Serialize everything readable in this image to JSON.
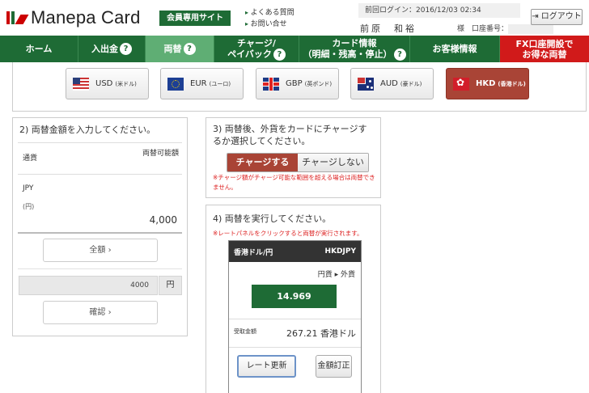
{
  "header": {
    "logo_text": "Manepa Card",
    "member_badge": "会員専用サイト",
    "links": [
      "よくある質問",
      "お問い合せ"
    ],
    "last_login": "前回ログイン：2016/12/03 02:34",
    "user_name": "前原　和裕",
    "account_label": "様　口座番号：",
    "logout_label": "ログアウト"
  },
  "nav": {
    "items": [
      {
        "label": "ホーム",
        "help": false
      },
      {
        "label": "入出金",
        "help": true
      },
      {
        "label": "両替",
        "help": true,
        "active": true
      },
      {
        "label_line1": "チャージ/",
        "label_line2": "ペイバック",
        "help": true
      },
      {
        "label_line1": "カード情報",
        "label_line2": "（明細・残高・停止）",
        "help": true
      },
      {
        "label": "お客様情報",
        "help": false
      },
      {
        "label_line1": "FX口座開設で",
        "label_line2": "お得な両替",
        "help": false
      }
    ],
    "help_glyph": "?"
  },
  "currencies": [
    {
      "code": "USD",
      "sub": "(米ドル)",
      "flag": "us-flag"
    },
    {
      "code": "EUR",
      "sub": "(ユーロ)",
      "flag": "eu-flag"
    },
    {
      "code": "GBP",
      "sub": "(英ポンド)",
      "flag": "gb-flag"
    },
    {
      "code": "AUD",
      "sub": "(豪ドル)",
      "flag": "au-flag"
    },
    {
      "code": "HKD",
      "sub": "(香港ドル)",
      "flag": "hk-flag",
      "active": true
    }
  ],
  "step2": {
    "title": "2) 両替金額を入力してください。",
    "col_currency": "通貨",
    "col_available": "両替可能額",
    "currency": "JPY",
    "currency_sub": "(円)",
    "balance": "4,000",
    "full_amount_button": "全額 ›",
    "input_value": "4000",
    "input_unit": "円",
    "confirm_button": "確認 ›"
  },
  "step3": {
    "title": "3) 両替後、外貨をカードにチャージするか選択してください。",
    "charge_on": "チャージする",
    "charge_off": "チャージしない",
    "note": "※チャージ額がチャージ可能な範囲を超える場合は両替できません。"
  },
  "step4": {
    "title": "4) 両替を実行してください。",
    "note": "※レートパネルをクリックすると両替が実行されます。",
    "pair_name": "香港ドル/円",
    "pair_code": "HKDJPY",
    "direction": "円貨 ▸ 外貨",
    "rate": "14.969",
    "receive_label": "受取金額",
    "receive_value": "267.21 香港ドル",
    "refresh_button": "レート更新",
    "fix_button": "金額訂正"
  },
  "colors": {
    "brand_green": "#1e6b35",
    "active_tab": "#5fae74",
    "accent_red": "#a94436",
    "promo_red": "#d11a1a"
  }
}
